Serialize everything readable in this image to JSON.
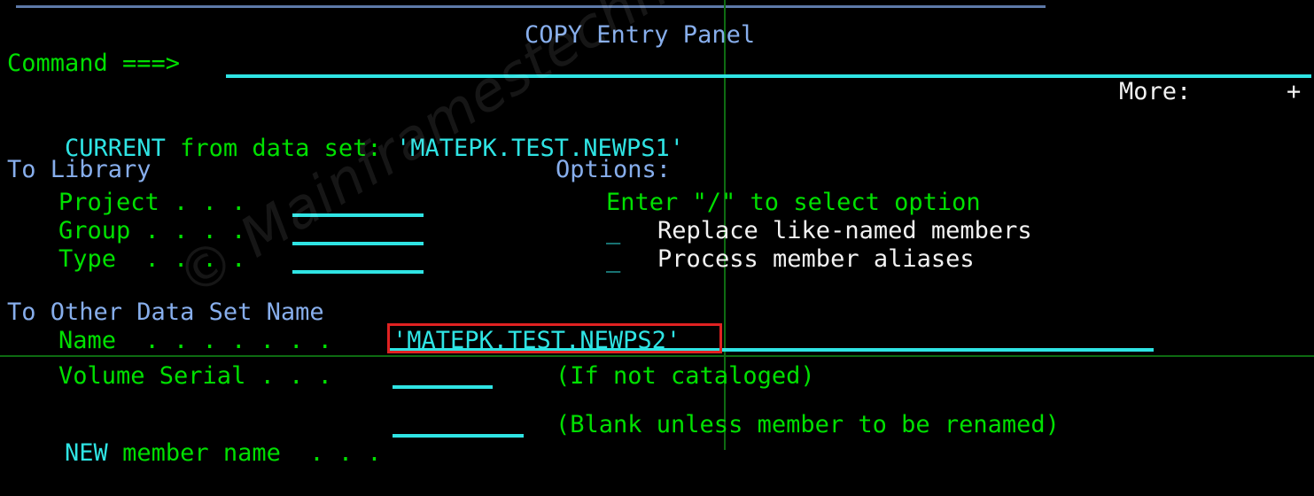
{
  "panel": {
    "title": "COPY Entry Panel",
    "command_label": "Command ===>",
    "command_value": "",
    "more_label": "More:",
    "more_indicator": "+"
  },
  "current": {
    "keyword": "CURRENT",
    "label": "from data set:",
    "dataset": "'MATEPK.TEST.NEWPS1'"
  },
  "to_library": {
    "heading": "To Library",
    "fields": [
      {
        "label": "Project . . .",
        "value": ""
      },
      {
        "label": "Group . . . .",
        "value": ""
      },
      {
        "label": "Type  . . . .",
        "value": ""
      }
    ]
  },
  "options": {
    "heading": "Options:",
    "instruction": "Enter \"/\" to select option",
    "items": [
      {
        "selector": "_",
        "label": "Replace like-named members",
        "selected": false
      },
      {
        "selector": "_",
        "label": "Process member aliases",
        "selected": false
      }
    ]
  },
  "to_other": {
    "heading": "To Other Data Set Name",
    "name_label": "Name  . . . . . . .",
    "name_value": "'MATEPK.TEST.NEWPS2'",
    "volume_label": "Volume Serial . . .",
    "volume_value": "",
    "volume_hint": "(If not cataloged)"
  },
  "new_member": {
    "keyword": "NEW",
    "label": "member name  . . .",
    "value": "",
    "hint": "(Blank unless member to be renamed)"
  },
  "watermark": {
    "text": "© Mainframestechhelp"
  },
  "colors": {
    "green": "#00E000",
    "cyan": "#2FE4E4",
    "blue": "#87AEEC",
    "white": "#F2F2F2",
    "highlight_red": "#E02222",
    "background": "#000000"
  }
}
